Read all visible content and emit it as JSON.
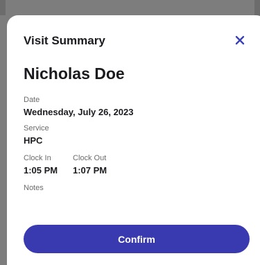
{
  "modal": {
    "title": "Visit Summary",
    "patient_name": "Nicholas Doe",
    "fields": {
      "date_label": "Date",
      "date_value": "Wednesday, July 26, 2023",
      "service_label": "Service",
      "service_value": "HPC",
      "clock_in_label": "Clock In",
      "clock_in_value": "1:05 PM",
      "clock_out_label": "Clock Out",
      "clock_out_value": "1:07 PM",
      "notes_label": "Notes"
    },
    "confirm_label": "Confirm",
    "close_icon": "close-icon"
  },
  "colors": {
    "accent": "#3a3ab0",
    "overlay": "#7d7d7d",
    "text": "#1b1b1f",
    "muted": "#6b6b6b"
  }
}
